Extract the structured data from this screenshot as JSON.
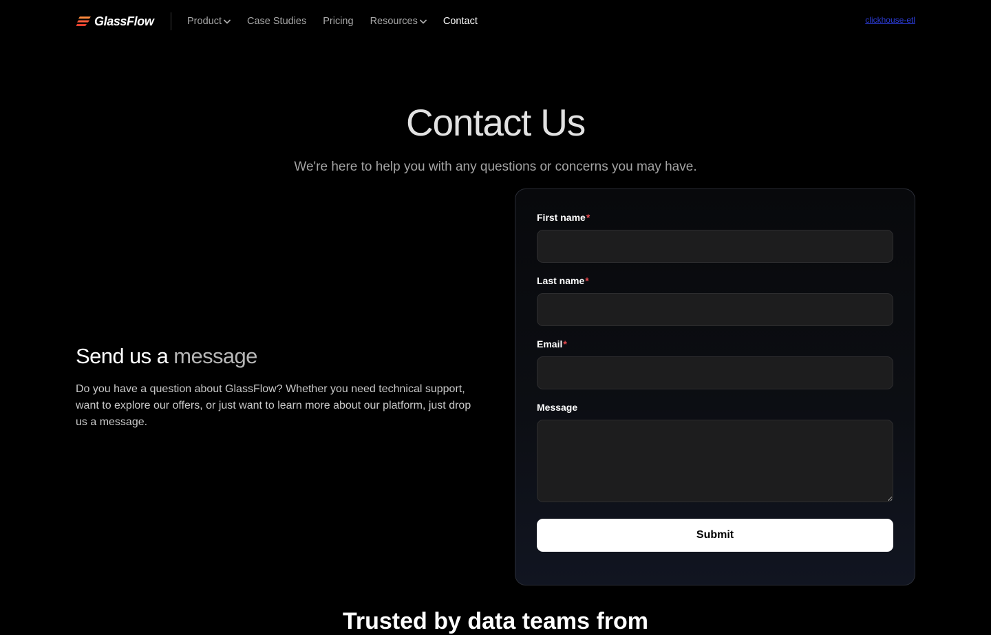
{
  "nav": {
    "logo_text": "GlassFlow",
    "links": [
      {
        "label": "Product",
        "has_dropdown": true,
        "active": false
      },
      {
        "label": "Case Studies",
        "has_dropdown": false,
        "active": false
      },
      {
        "label": "Pricing",
        "has_dropdown": false,
        "active": false
      },
      {
        "label": "Resources",
        "has_dropdown": true,
        "active": false
      },
      {
        "label": "Contact",
        "has_dropdown": false,
        "active": true
      }
    ],
    "right_link": "clickhouse-etl"
  },
  "hero": {
    "title": "Contact Us",
    "subtitle": "We're here to help you with any questions or concerns you may have."
  },
  "intro": {
    "heading_part1": "Send us a ",
    "heading_part2": "message",
    "body": "Do you have a question about GlassFlow? Whether you need technical support, want to explore our offers, or just want to learn more about our platform, just drop us a message."
  },
  "form": {
    "fields": [
      {
        "label": "First name",
        "required": true,
        "value": ""
      },
      {
        "label": "Last name",
        "required": true,
        "value": ""
      },
      {
        "label": "Email",
        "required": true,
        "value": ""
      },
      {
        "label": "Message",
        "required": false,
        "value": ""
      }
    ],
    "required_marker": "*",
    "submit_label": "Submit"
  },
  "next_section": {
    "heading": "Trusted by data teams from"
  },
  "colors": {
    "background": "#000000",
    "accent_required": "#e5484d",
    "logo_accent": "#ff6a3d",
    "link": "#2b3bd6"
  }
}
